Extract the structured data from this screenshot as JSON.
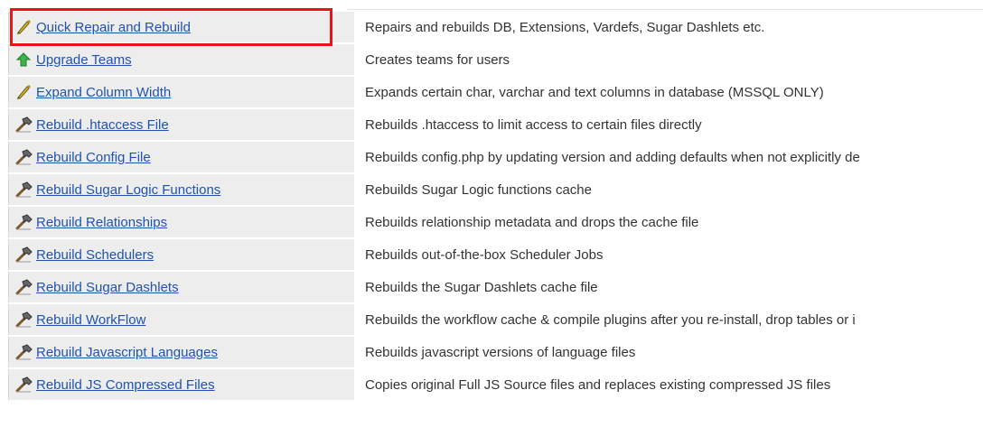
{
  "rows": [
    {
      "label": "Quick Repair and Rebuild",
      "icon": "pencil-icon",
      "desc": "Repairs and rebuilds DB, Extensions, Vardefs, Sugar Dashlets etc."
    },
    {
      "label": "Upgrade Teams",
      "icon": "up-arrow-icon",
      "desc": "Creates teams for users"
    },
    {
      "label": "Expand Column Width",
      "icon": "pencil-icon",
      "desc": "Expands certain char, varchar and text columns in database (MSSQL ONLY)"
    },
    {
      "label": "Rebuild .htaccess File",
      "icon": "hammer-icon",
      "desc": "Rebuilds .htaccess to limit access to certain files directly"
    },
    {
      "label": "Rebuild Config File",
      "icon": "hammer-icon",
      "desc": "Rebuilds config.php by updating version and adding defaults when not explicitly de"
    },
    {
      "label": "Rebuild Sugar Logic Functions",
      "icon": "hammer-icon",
      "desc": "Rebuilds Sugar Logic functions cache"
    },
    {
      "label": "Rebuild Relationships",
      "icon": "hammer-icon",
      "desc": "Rebuilds relationship metadata and drops the cache file"
    },
    {
      "label": "Rebuild Schedulers",
      "icon": "hammer-icon",
      "desc": "Rebuilds out-of-the-box Scheduler Jobs"
    },
    {
      "label": "Rebuild Sugar Dashlets",
      "icon": "hammer-icon",
      "desc": "Rebuilds the Sugar Dashlets cache file"
    },
    {
      "label": "Rebuild WorkFlow",
      "icon": "hammer-icon",
      "desc": "Rebuilds the workflow cache & compile plugins after you re-install, drop tables or i"
    },
    {
      "label": "Rebuild Javascript Languages",
      "icon": "hammer-icon",
      "desc": "Rebuilds javascript versions of language files"
    },
    {
      "label": "Rebuild JS Compressed Files",
      "icon": "hammer-icon",
      "desc": "Copies original Full JS Source files and replaces existing compressed JS files"
    }
  ],
  "colors": {
    "link": "#1f53b3",
    "highlight": "#e8131b",
    "row_bg": "#ededed"
  }
}
